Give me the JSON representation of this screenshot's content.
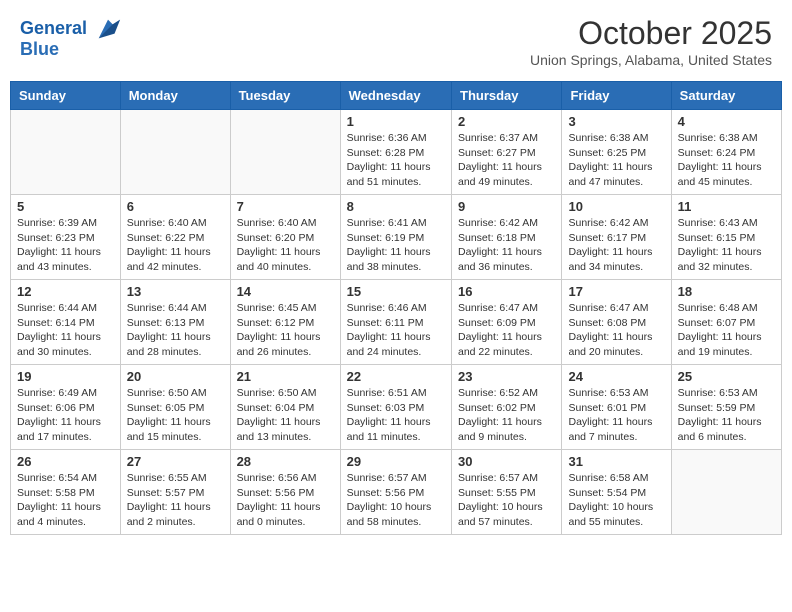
{
  "header": {
    "logo_line1": "General",
    "logo_line2": "Blue",
    "month": "October 2025",
    "location": "Union Springs, Alabama, United States"
  },
  "weekdays": [
    "Sunday",
    "Monday",
    "Tuesday",
    "Wednesday",
    "Thursday",
    "Friday",
    "Saturday"
  ],
  "weeks": [
    [
      {
        "day": "",
        "info": ""
      },
      {
        "day": "",
        "info": ""
      },
      {
        "day": "",
        "info": ""
      },
      {
        "day": "1",
        "info": "Sunrise: 6:36 AM\nSunset: 6:28 PM\nDaylight: 11 hours\nand 51 minutes."
      },
      {
        "day": "2",
        "info": "Sunrise: 6:37 AM\nSunset: 6:27 PM\nDaylight: 11 hours\nand 49 minutes."
      },
      {
        "day": "3",
        "info": "Sunrise: 6:38 AM\nSunset: 6:25 PM\nDaylight: 11 hours\nand 47 minutes."
      },
      {
        "day": "4",
        "info": "Sunrise: 6:38 AM\nSunset: 6:24 PM\nDaylight: 11 hours\nand 45 minutes."
      }
    ],
    [
      {
        "day": "5",
        "info": "Sunrise: 6:39 AM\nSunset: 6:23 PM\nDaylight: 11 hours\nand 43 minutes."
      },
      {
        "day": "6",
        "info": "Sunrise: 6:40 AM\nSunset: 6:22 PM\nDaylight: 11 hours\nand 42 minutes."
      },
      {
        "day": "7",
        "info": "Sunrise: 6:40 AM\nSunset: 6:20 PM\nDaylight: 11 hours\nand 40 minutes."
      },
      {
        "day": "8",
        "info": "Sunrise: 6:41 AM\nSunset: 6:19 PM\nDaylight: 11 hours\nand 38 minutes."
      },
      {
        "day": "9",
        "info": "Sunrise: 6:42 AM\nSunset: 6:18 PM\nDaylight: 11 hours\nand 36 minutes."
      },
      {
        "day": "10",
        "info": "Sunrise: 6:42 AM\nSunset: 6:17 PM\nDaylight: 11 hours\nand 34 minutes."
      },
      {
        "day": "11",
        "info": "Sunrise: 6:43 AM\nSunset: 6:15 PM\nDaylight: 11 hours\nand 32 minutes."
      }
    ],
    [
      {
        "day": "12",
        "info": "Sunrise: 6:44 AM\nSunset: 6:14 PM\nDaylight: 11 hours\nand 30 minutes."
      },
      {
        "day": "13",
        "info": "Sunrise: 6:44 AM\nSunset: 6:13 PM\nDaylight: 11 hours\nand 28 minutes."
      },
      {
        "day": "14",
        "info": "Sunrise: 6:45 AM\nSunset: 6:12 PM\nDaylight: 11 hours\nand 26 minutes."
      },
      {
        "day": "15",
        "info": "Sunrise: 6:46 AM\nSunset: 6:11 PM\nDaylight: 11 hours\nand 24 minutes."
      },
      {
        "day": "16",
        "info": "Sunrise: 6:47 AM\nSunset: 6:09 PM\nDaylight: 11 hours\nand 22 minutes."
      },
      {
        "day": "17",
        "info": "Sunrise: 6:47 AM\nSunset: 6:08 PM\nDaylight: 11 hours\nand 20 minutes."
      },
      {
        "day": "18",
        "info": "Sunrise: 6:48 AM\nSunset: 6:07 PM\nDaylight: 11 hours\nand 19 minutes."
      }
    ],
    [
      {
        "day": "19",
        "info": "Sunrise: 6:49 AM\nSunset: 6:06 PM\nDaylight: 11 hours\nand 17 minutes."
      },
      {
        "day": "20",
        "info": "Sunrise: 6:50 AM\nSunset: 6:05 PM\nDaylight: 11 hours\nand 15 minutes."
      },
      {
        "day": "21",
        "info": "Sunrise: 6:50 AM\nSunset: 6:04 PM\nDaylight: 11 hours\nand 13 minutes."
      },
      {
        "day": "22",
        "info": "Sunrise: 6:51 AM\nSunset: 6:03 PM\nDaylight: 11 hours\nand 11 minutes."
      },
      {
        "day": "23",
        "info": "Sunrise: 6:52 AM\nSunset: 6:02 PM\nDaylight: 11 hours\nand 9 minutes."
      },
      {
        "day": "24",
        "info": "Sunrise: 6:53 AM\nSunset: 6:01 PM\nDaylight: 11 hours\nand 7 minutes."
      },
      {
        "day": "25",
        "info": "Sunrise: 6:53 AM\nSunset: 5:59 PM\nDaylight: 11 hours\nand 6 minutes."
      }
    ],
    [
      {
        "day": "26",
        "info": "Sunrise: 6:54 AM\nSunset: 5:58 PM\nDaylight: 11 hours\nand 4 minutes."
      },
      {
        "day": "27",
        "info": "Sunrise: 6:55 AM\nSunset: 5:57 PM\nDaylight: 11 hours\nand 2 minutes."
      },
      {
        "day": "28",
        "info": "Sunrise: 6:56 AM\nSunset: 5:56 PM\nDaylight: 11 hours\nand 0 minutes."
      },
      {
        "day": "29",
        "info": "Sunrise: 6:57 AM\nSunset: 5:56 PM\nDaylight: 10 hours\nand 58 minutes."
      },
      {
        "day": "30",
        "info": "Sunrise: 6:57 AM\nSunset: 5:55 PM\nDaylight: 10 hours\nand 57 minutes."
      },
      {
        "day": "31",
        "info": "Sunrise: 6:58 AM\nSunset: 5:54 PM\nDaylight: 10 hours\nand 55 minutes."
      },
      {
        "day": "",
        "info": ""
      }
    ]
  ]
}
